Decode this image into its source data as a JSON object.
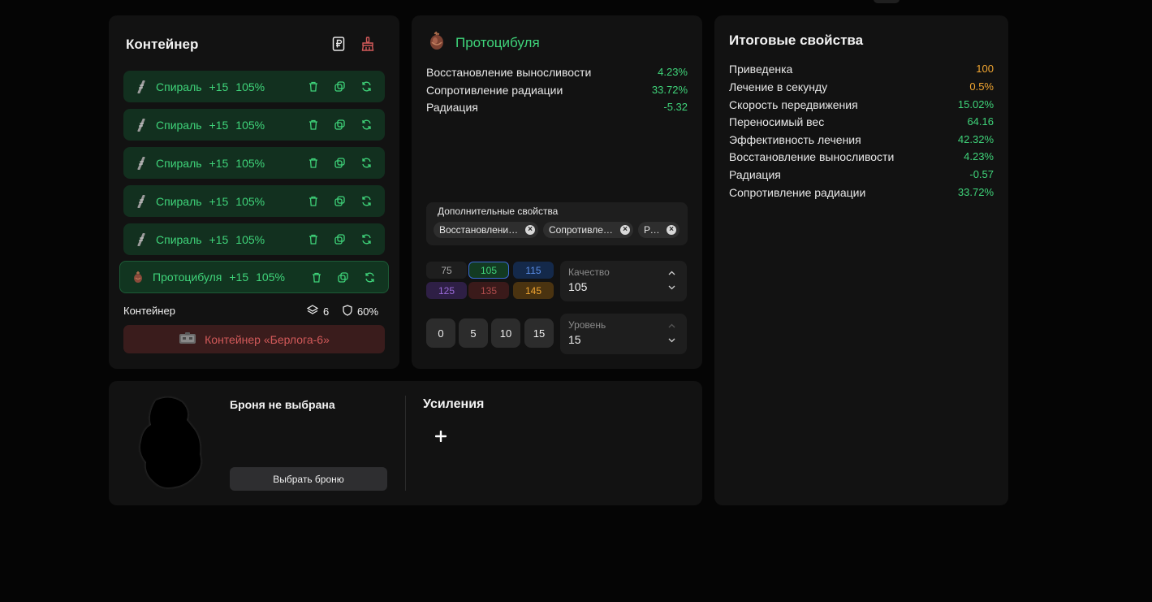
{
  "container_panel": {
    "title": "Контейнер",
    "slots": [
      {
        "name": "Спираль",
        "level": "+15",
        "quality": "105%"
      },
      {
        "name": "Спираль",
        "level": "+15",
        "quality": "105%"
      },
      {
        "name": "Спираль",
        "level": "+15",
        "quality": "105%"
      },
      {
        "name": "Спираль",
        "level": "+15",
        "quality": "105%"
      },
      {
        "name": "Спираль",
        "level": "+15",
        "quality": "105%"
      },
      {
        "name": "Протоцибуля",
        "level": "+15",
        "quality": "105%"
      }
    ],
    "footer_label": "Контейнер",
    "slots_count": "6",
    "protection": "60%",
    "selected_container": "Контейнер «Берлога-6»"
  },
  "artifact_panel": {
    "name": "Протоцибуля",
    "properties": [
      {
        "label": "Восстановление выносливости",
        "value": "4.23%"
      },
      {
        "label": "Сопротивление радиации",
        "value": "33.72%"
      },
      {
        "label": "Радиация",
        "value": "-5.32"
      }
    ],
    "extra_title": "Дополнительные свойства",
    "extra_chips": [
      "Восстановление выносливости",
      "Сопротивление радиации",
      "Радиация"
    ],
    "quality_options": [
      "75",
      "105",
      "115",
      "125",
      "135",
      "145"
    ],
    "quality_label": "Качество",
    "quality_value": "105",
    "level_options": [
      "0",
      "5",
      "10",
      "15"
    ],
    "level_label": "Уровень",
    "level_value": "15"
  },
  "summary_panel": {
    "title": "Итоговые свойства",
    "rows": [
      {
        "label": "Приведенка",
        "value": "100",
        "color": "#f0a531"
      },
      {
        "label": "Лечение в секунду",
        "value": "0.5%",
        "color": "#f0a531"
      },
      {
        "label": "Скорость передвижения",
        "value": "15.02%",
        "color": "#3fd47a"
      },
      {
        "label": "Переносимый вес",
        "value": "64.16",
        "color": "#3fd47a"
      },
      {
        "label": "Эффективность лечения",
        "value": "42.32%",
        "color": "#3fd47a"
      },
      {
        "label": "Восстановление выносливости",
        "value": "4.23%",
        "color": "#3fd47a"
      },
      {
        "label": "Радиация",
        "value": "-0.57",
        "color": "#3fd47a"
      },
      {
        "label": "Сопротивление радиации",
        "value": "33.72%",
        "color": "#3fd47a"
      }
    ]
  },
  "armor_panel": {
    "status": "Броня не выбрана",
    "choose_button": "Выбрать броню",
    "boosts_title": "Усиления"
  },
  "colors": {
    "accent_green": "#3fd47a",
    "accent_orange": "#f0a531",
    "accent_red": "#d35a5a"
  }
}
